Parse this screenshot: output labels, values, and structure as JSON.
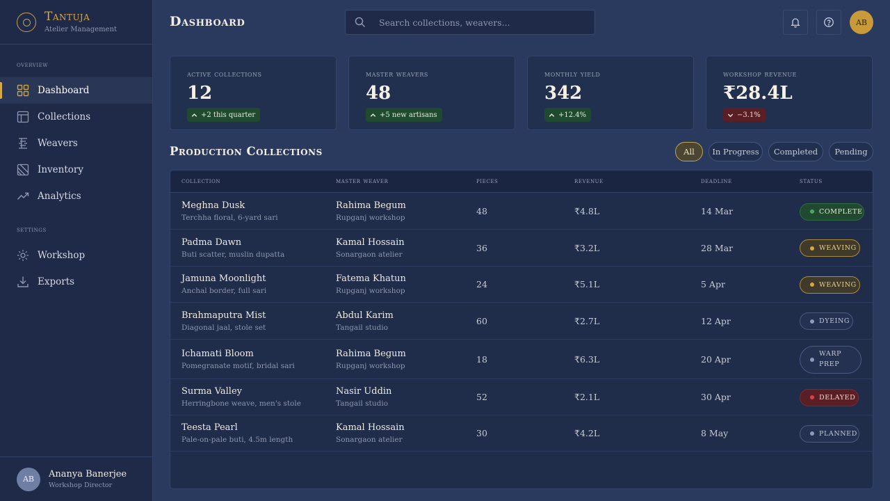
{
  "brand": {
    "name": "Tantuja",
    "subtitle": "Atelier Management"
  },
  "sidebar": {
    "section_overview": "Overview",
    "section_settings": "Settings",
    "items": [
      {
        "label": "Dashboard",
        "icon": "grid-icon",
        "active": true
      },
      {
        "label": "Collections",
        "icon": "layout-icon"
      },
      {
        "label": "Weavers",
        "icon": "loom-icon"
      },
      {
        "label": "Inventory",
        "icon": "box-icon"
      },
      {
        "label": "Analytics",
        "icon": "trend-icon"
      },
      {
        "label": "Workshop",
        "icon": "gear-icon"
      },
      {
        "label": "Exports",
        "icon": "download-icon"
      }
    ],
    "user": {
      "initials": "AB",
      "name": "Ananya Banerjee",
      "role": "Workshop Director"
    }
  },
  "header": {
    "title": "Dashboard",
    "search_placeholder": "Search collections, weavers...",
    "avatar_initials": "AB"
  },
  "stats": [
    {
      "label": "Active Collections",
      "value": "12",
      "delta": "+2 this quarter",
      "trend": "up"
    },
    {
      "label": "Master Weavers",
      "value": "48",
      "delta": "+5 new artisans",
      "trend": "up"
    },
    {
      "label": "Monthly Yield",
      "value": "342",
      "delta": "+12.4%",
      "trend": "up"
    },
    {
      "label": "Workshop Revenue",
      "value": "₹28.4L",
      "delta": "−3.1%",
      "trend": "down"
    }
  ],
  "section": {
    "title": "Production Collections",
    "filters": [
      "All",
      "In Progress",
      "Completed",
      "Pending"
    ],
    "active_filter": "All"
  },
  "table": {
    "headers": [
      "Collection",
      "Master Weaver",
      "Pieces",
      "Revenue",
      "Deadline",
      "Status"
    ],
    "rows": [
      {
        "name": "Meghna Dusk",
        "desc": "Terchha floral, 6-yard sari",
        "weaver": "Rahima Begum",
        "place": "Rupganj workshop",
        "pieces": "48",
        "revenue": "₹4.8L",
        "deadline": "14 Mar",
        "status": "Complete",
        "status_type": "complete"
      },
      {
        "name": "Padma Dawn",
        "desc": "Buti scatter, muslin dupatta",
        "weaver": "Kamal Hossain",
        "place": "Sonargaon atelier",
        "pieces": "36",
        "revenue": "₹3.2L",
        "deadline": "28 Mar",
        "status": "Weaving",
        "status_type": "weaving"
      },
      {
        "name": "Jamuna Moonlight",
        "desc": "Anchal border, full sari",
        "weaver": "Fatema Khatun",
        "place": "Rupganj workshop",
        "pieces": "24",
        "revenue": "₹5.1L",
        "deadline": "5 Apr",
        "status": "Weaving",
        "status_type": "weaving"
      },
      {
        "name": "Brahmaputra Mist",
        "desc": "Diagonal jaal, stole set",
        "weaver": "Abdul Karim",
        "place": "Tangail studio",
        "pieces": "60",
        "revenue": "₹2.7L",
        "deadline": "12 Apr",
        "status": "Dyeing",
        "status_type": "neutral"
      },
      {
        "name": "Ichamati Bloom",
        "desc": "Pomegranate motif, bridal sari",
        "weaver": "Rahima Begum",
        "place": "Rupganj workshop",
        "pieces": "18",
        "revenue": "₹6.3L",
        "deadline": "20 Apr",
        "status": "Warp Prep",
        "status_type": "neutral"
      },
      {
        "name": "Surma Valley",
        "desc": "Herringbone weave, men's stole",
        "weaver": "Nasir Uddin",
        "place": "Tangail studio",
        "pieces": "52",
        "revenue": "₹2.1L",
        "deadline": "30 Apr",
        "status": "Delayed",
        "status_type": "delayed"
      },
      {
        "name": "Teesta Pearl",
        "desc": "Pale-on-pale buti, 4.5m length",
        "weaver": "Kamal Hossain",
        "place": "Sonargaon atelier",
        "pieces": "30",
        "revenue": "₹4.2L",
        "deadline": "8 May",
        "status": "Planned",
        "status_type": "neutral"
      }
    ]
  },
  "colors": {
    "accent": "#d4a84a",
    "background": "#2a3a5e",
    "sidebar": "#1e2a48"
  }
}
